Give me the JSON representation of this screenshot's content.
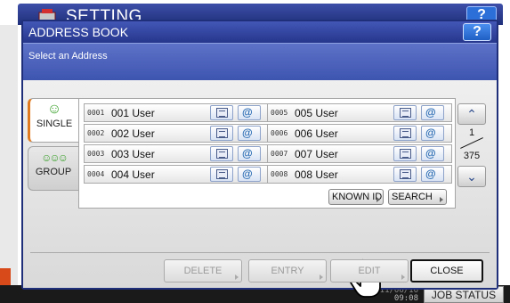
{
  "outer": {
    "title": "SETTING",
    "help_label": "?",
    "clock_line1": "2011/06/16",
    "clock_line2": "09:08",
    "job_status_label": "JOB STATUS"
  },
  "dialog": {
    "title": "ADDRESS BOOK",
    "help_label": "?",
    "instruction": "Select an Address"
  },
  "tabs": [
    {
      "label": "SINGLE",
      "icon": "single-person-icon"
    },
    {
      "label": "GROUP",
      "icon": "group-people-icon"
    }
  ],
  "addresses": [
    {
      "num": "0001",
      "name": "001 User"
    },
    {
      "num": "0002",
      "name": "002 User"
    },
    {
      "num": "0003",
      "name": "003 User"
    },
    {
      "num": "0004",
      "name": "004 User"
    },
    {
      "num": "0005",
      "name": "005 User"
    },
    {
      "num": "0006",
      "name": "006 User"
    },
    {
      "num": "0007",
      "name": "007 User"
    },
    {
      "num": "0008",
      "name": "008 User"
    }
  ],
  "pager": {
    "current": "1",
    "total": "375"
  },
  "search_buttons": {
    "known_id": "KNOWN ID",
    "search": "SEARCH"
  },
  "actions": {
    "delete": "DELETE",
    "entry": "ENTRY",
    "edit": "EDIT",
    "close": "CLOSE"
  },
  "colors": {
    "title_bar": "#25368c",
    "subbar": "#4a60bb",
    "accent": "#e07a20",
    "icon_green": "#3aa12b"
  }
}
